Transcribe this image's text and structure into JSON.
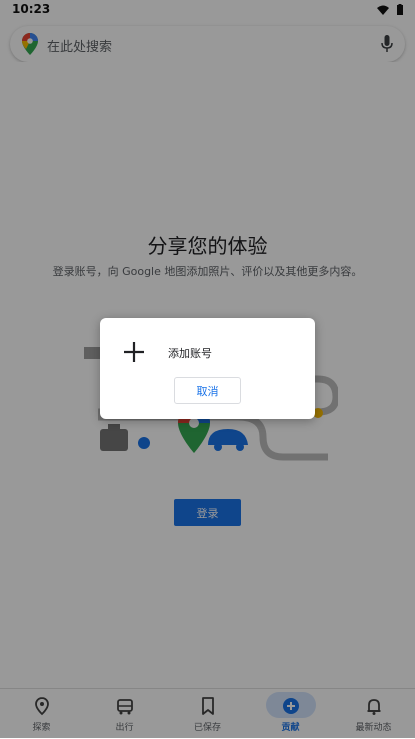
{
  "status_bar": {
    "time": "10:23"
  },
  "search": {
    "placeholder": "在此处搜索"
  },
  "hero": {
    "title": "分享您的体验",
    "subtitle": "登录账号，向 Google 地图添加照片、评价以及其他更多内容。",
    "login_label": "登录"
  },
  "dialog": {
    "add_account_label": "添加账号",
    "cancel_label": "取消"
  },
  "bottom_nav": {
    "items": [
      {
        "label": "探索",
        "icon": "location-pin-icon"
      },
      {
        "label": "出行",
        "icon": "commute-icon"
      },
      {
        "label": "已保存",
        "icon": "bookmark-icon"
      },
      {
        "label": "贡献",
        "icon": "add-circle-icon",
        "active": true
      },
      {
        "label": "最新动态",
        "icon": "bell-icon"
      }
    ]
  },
  "colors": {
    "accent": "#1a73e8",
    "scrim": "rgba(0,0,0,0.40)"
  }
}
